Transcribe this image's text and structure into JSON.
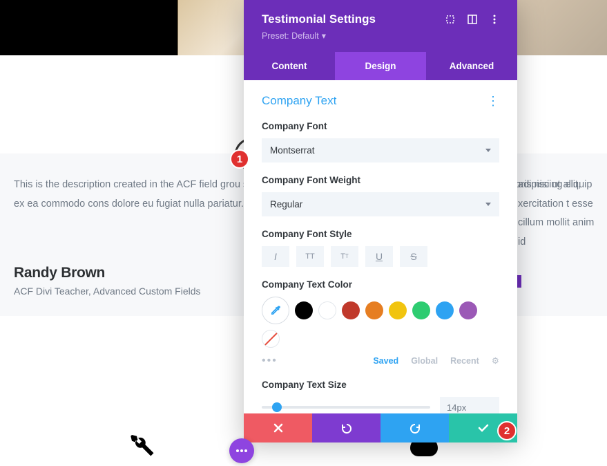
{
  "header": {
    "title": "Testimonial Settings",
    "preset_label": "Preset: Default"
  },
  "tabs": {
    "content": "Content",
    "design": "Design",
    "advanced": "Advanced"
  },
  "section": {
    "title": "Company Text"
  },
  "labels": {
    "font": "Company Font",
    "weight": "Company Font Weight",
    "style": "Company Font Style",
    "color": "Company Text Color",
    "size": "Company Text Size"
  },
  "values": {
    "font": "Montserrat",
    "weight": "Regular",
    "size": "14px"
  },
  "color_swatches": [
    "#000000",
    "#ffffff",
    "#c0392b",
    "#e67e22",
    "#f1c40f",
    "#2ecc71",
    "#2ea3f2",
    "#9b59b6"
  ],
  "color_tabs": {
    "saved": "Saved",
    "global": "Global",
    "recent": "Recent"
  },
  "testimonial": {
    "body": "This is the description created in the ACF field grou\nsed do eiusmod tempor incididunt ut labore et dol\nullamco laboris nisi ut aliquip ex ea commodo cons\ndolore eu fugiat nulla pariatur. Excepteur sint occae\nest laborum.",
    "body_right": "adipiscing elit,\nxercitation\nt esse cillum\nmollit anim id",
    "name": "Randy Brown",
    "title": "ACF Divi Teacher, Advanced Custom Fields"
  },
  "badges": {
    "one": "1",
    "two": "2"
  }
}
